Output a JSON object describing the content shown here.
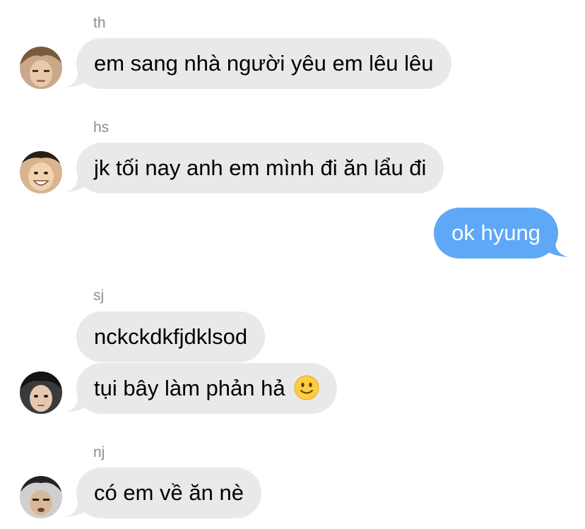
{
  "messages": [
    {
      "sender": "th",
      "text": "em sang nhà người yêu em lêu lêu"
    },
    {
      "sender": "hs",
      "text": "jk tối nay anh em mình đi ăn lẩu đi"
    },
    {
      "text": "ok hyung"
    },
    {
      "sender": "sj",
      "text": "nckckdkfjdklsod"
    },
    {
      "text": "tụi bây làm phản hả",
      "emoji": "slightly-smiling-face-icon"
    },
    {
      "sender": "nj",
      "text": "có em về ăn nè"
    }
  ],
  "colors": {
    "incoming_bubble": "#e9e9eb",
    "outgoing_bubble": "#5ea8f7",
    "sender_name": "#8e8e93"
  }
}
